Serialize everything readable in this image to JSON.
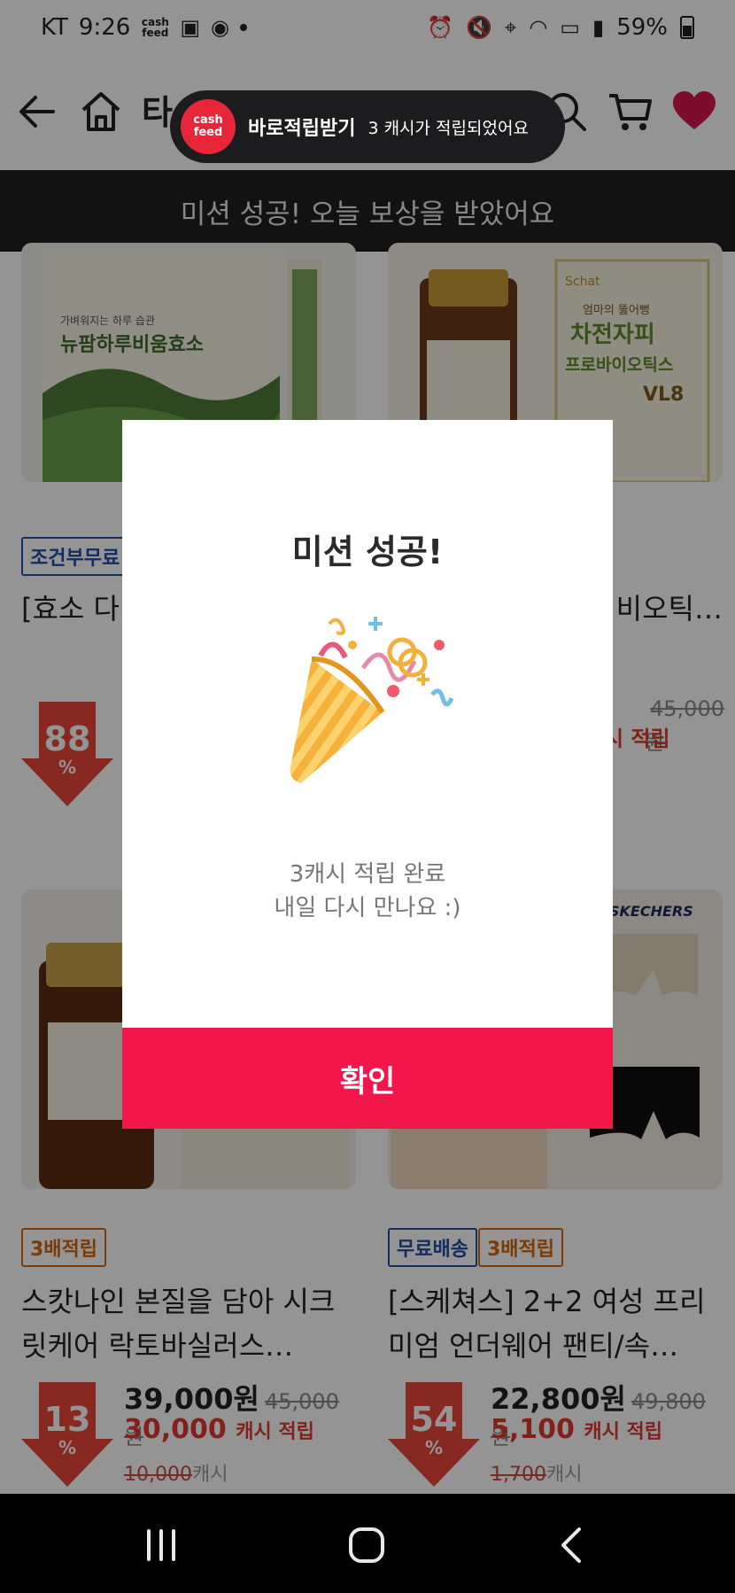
{
  "status_bar": {
    "carrier": "KT",
    "time": "9:26",
    "cashfeed_icon_text": "cash feed",
    "battery": "59%"
  },
  "header": {
    "title_partial": "타"
  },
  "mission_banner": "미션 성공! 오늘 보상을 받았어요",
  "products": [
    {
      "tags": [
        "조건부무료"
      ],
      "title": "[효소 다 이어트 히",
      "discount": "88",
      "discount_unit": "%"
    },
    {
      "tags": [],
      "title": "뚫어뻥 비오틱…",
      "original_price": "45,000원",
      "cash_text": "시 적립"
    },
    {
      "tags": [
        "3배적립"
      ],
      "title": "스캇나인 본질을 담아 시크릿케어 락토바실러스…",
      "discount": "13",
      "discount_unit": "%",
      "price": "39,000원",
      "original_price": "45,000원",
      "cash_amount": "30,000",
      "cash_label": "캐시 적립",
      "cash_original": "10,000",
      "cash_original_unit": "캐시"
    },
    {
      "tags": [
        "무료배송",
        "3배적립"
      ],
      "title": "[스케쳐스] 2+2 여성 프리미엄 언더웨어 팬티/속…",
      "discount": "54",
      "discount_unit": "%",
      "price": "22,800원",
      "original_price": "49,800원",
      "cash_amount": "5,100",
      "cash_label": "캐시 적립",
      "cash_original": "1,700",
      "cash_original_unit": "캐시"
    }
  ],
  "product_image_text": {
    "p1_line1": "가벼워지는 하루 습관",
    "p1_line2": "뉴팜하루비움효소",
    "p2_brand": "Schat",
    "p2_line1": "엄마의 뚫어뻥",
    "p2_line2": "차전자피",
    "p2_line3": "프로바이오틱스",
    "p2_line4": "VL8",
    "p4_brand": "SKECHERS"
  },
  "toast": {
    "logo_text": "cash feed",
    "title": "바로적립받기",
    "message": "3 캐시가 적립되었어요"
  },
  "modal": {
    "title": "미션 성공!",
    "message_line1": "3캐시 적립 완료",
    "message_line2": "내일 다시 만나요 :)",
    "confirm_label": "확인"
  },
  "colors": {
    "accent": "#f2174b",
    "toast_logo": "#e8263a",
    "discount": "#e8473a",
    "cash": "#e03a2e",
    "banner": "#1f1f22"
  }
}
